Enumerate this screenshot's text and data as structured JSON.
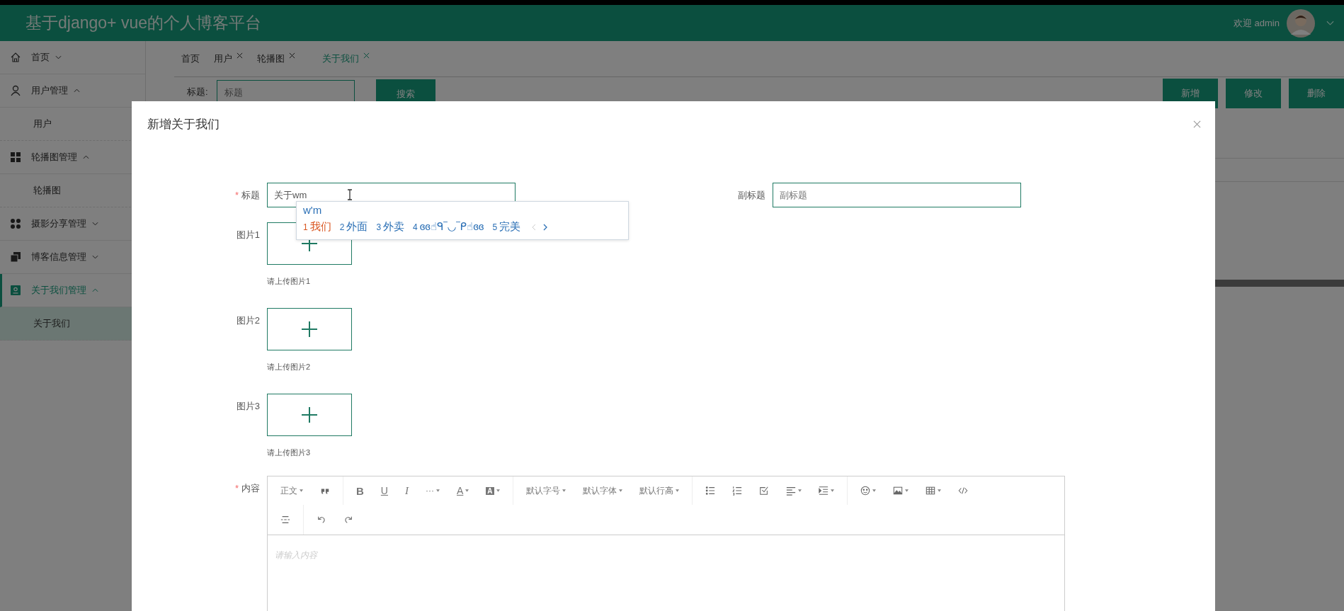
{
  "header": {
    "title": "基于django+ vue的个人博客平台",
    "welcome": "欢迎 admin"
  },
  "sidebar": {
    "items": [
      {
        "label": "首页",
        "expanded": false,
        "selected": false
      },
      {
        "label": "用户管理",
        "expanded": true,
        "selected": false,
        "children": [
          {
            "label": "用户",
            "selected": false
          }
        ]
      },
      {
        "label": "轮播图管理",
        "expanded": true,
        "selected": false,
        "children": [
          {
            "label": "轮播图",
            "selected": false
          }
        ]
      },
      {
        "label": "摄影分享管理",
        "expanded": false,
        "selected": false
      },
      {
        "label": "博客信息管理",
        "expanded": false,
        "selected": false
      },
      {
        "label": "关于我们管理",
        "expanded": true,
        "selected": true,
        "children": [
          {
            "label": "关于我们",
            "selected": true
          }
        ]
      }
    ]
  },
  "tabs": [
    {
      "label": "首页",
      "closable": false,
      "selected": false
    },
    {
      "label": "用户",
      "closable": true,
      "selected": false
    },
    {
      "label": "轮播图",
      "closable": true,
      "selected": false
    },
    {
      "label": "关于我们",
      "closable": true,
      "selected": true
    }
  ],
  "search": {
    "label": "标题:",
    "placeholder": "标题",
    "button": "搜索"
  },
  "actions": [
    "新增",
    "修改",
    "删除"
  ],
  "dialog": {
    "title": "新增关于我们",
    "title_field": {
      "required_mark": "*",
      "label": "标题",
      "value": "关于wm"
    },
    "subtitle_field": {
      "label": "副标题",
      "placeholder": "副标题"
    },
    "uploads": [
      {
        "label": "图片1",
        "hint": "请上传图片1"
      },
      {
        "label": "图片2",
        "hint": "请上传图片2"
      },
      {
        "label": "图片3",
        "hint": "请上传图片3"
      }
    ],
    "content": {
      "required_mark": "*",
      "label": "内容",
      "placeholder": "请输入内容",
      "toolbar_rows": [
        [
          [
            {
              "kind": "text",
              "label": "正文",
              "caret": true
            },
            {
              "kind": "quote",
              "caret": false
            }
          ],
          [
            {
              "kind": "bold",
              "label": "B",
              "caret": false
            },
            {
              "kind": "underline",
              "label": "U",
              "caret": false
            },
            {
              "kind": "italic",
              "label": "I",
              "caret": false
            },
            {
              "kind": "text",
              "label": "···",
              "caret": true
            },
            {
              "kind": "fontcolor",
              "label": "A",
              "caret": true
            },
            {
              "kind": "bgcolor",
              "label": "A",
              "caret": true
            }
          ],
          [
            {
              "kind": "text",
              "label": "默认字号",
              "caret": true
            },
            {
              "kind": "text",
              "label": "默认字体",
              "caret": true
            },
            {
              "kind": "text",
              "label": "默认行高",
              "caret": true
            }
          ],
          [
            {
              "kind": "bullets",
              "caret": false
            },
            {
              "kind": "numbers",
              "caret": false
            },
            {
              "kind": "checklist",
              "caret": false
            },
            {
              "kind": "align",
              "caret": true
            },
            {
              "kind": "indent",
              "caret": true
            }
          ],
          [
            {
              "kind": "emoji",
              "caret": true
            },
            {
              "kind": "image",
              "caret": true
            },
            {
              "kind": "table",
              "caret": true
            },
            {
              "kind": "code",
              "caret": false
            }
          ]
        ],
        [
          [
            {
              "kind": "divider",
              "caret": false
            }
          ],
          [
            {
              "kind": "undo",
              "caret": false
            },
            {
              "kind": "redo",
              "caret": false
            }
          ]
        ]
      ]
    }
  },
  "ime": {
    "composition": "w'm",
    "candidates": [
      {
        "index": "1",
        "text": "我们",
        "selected": true
      },
      {
        "index": "2",
        "text": "外面",
        "selected": false
      },
      {
        "index": "3",
        "text": "外卖",
        "selected": false
      },
      {
        "index": "4",
        "text": "ɞɞ☝ᑫ‾◡‾ᑭ☝ɞɞ",
        "selected": false
      },
      {
        "index": "5",
        "text": "完美",
        "selected": false
      }
    ]
  }
}
